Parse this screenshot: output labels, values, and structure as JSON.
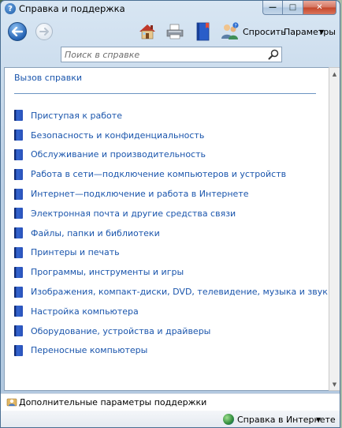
{
  "window": {
    "title": "Справка и поддержка",
    "minimize_glyph": "—",
    "maximize_glyph": "□",
    "close_glyph": "✕"
  },
  "toolbar": {
    "ask_label": "Спросить",
    "options_label": "Параметры",
    "options_arrow": "▼",
    "icons": [
      "back-arrow-icon",
      "forward-arrow-icon",
      "home-icon",
      "printer-icon",
      "browse-help-icon",
      "ask-people-icon"
    ]
  },
  "search": {
    "placeholder": "Поиск в справке"
  },
  "content": {
    "section_link": "Вызов справки",
    "topics": [
      "Приступая к работе",
      "Безопасность и конфиденциальность",
      "Обслуживание и производительность",
      "Работа в сети—подключение компьютеров и устройств",
      "Интернет—подключение и работа в Интернете",
      "Электронная почта и другие средства связи",
      "Файлы, папки и библиотеки",
      "Принтеры и печать",
      "Программы, инструменты и игры",
      "Изображения, компакт-диски, DVD, телевидение, музыка и звук",
      "Настройка компьютера",
      "Оборудование, устройства и драйверы",
      "Переносные компьютеры"
    ]
  },
  "scrollbar": {
    "up_glyph": "▲",
    "down_glyph": "▼"
  },
  "footer": {
    "support_text": "Дополнительные параметры поддержки",
    "online_text": "Справка в Интернете",
    "online_arrow": "▼"
  },
  "colors": {
    "link": "#1a55ac",
    "book": "#2a51b8",
    "window_frame": "#bcd1e6"
  }
}
